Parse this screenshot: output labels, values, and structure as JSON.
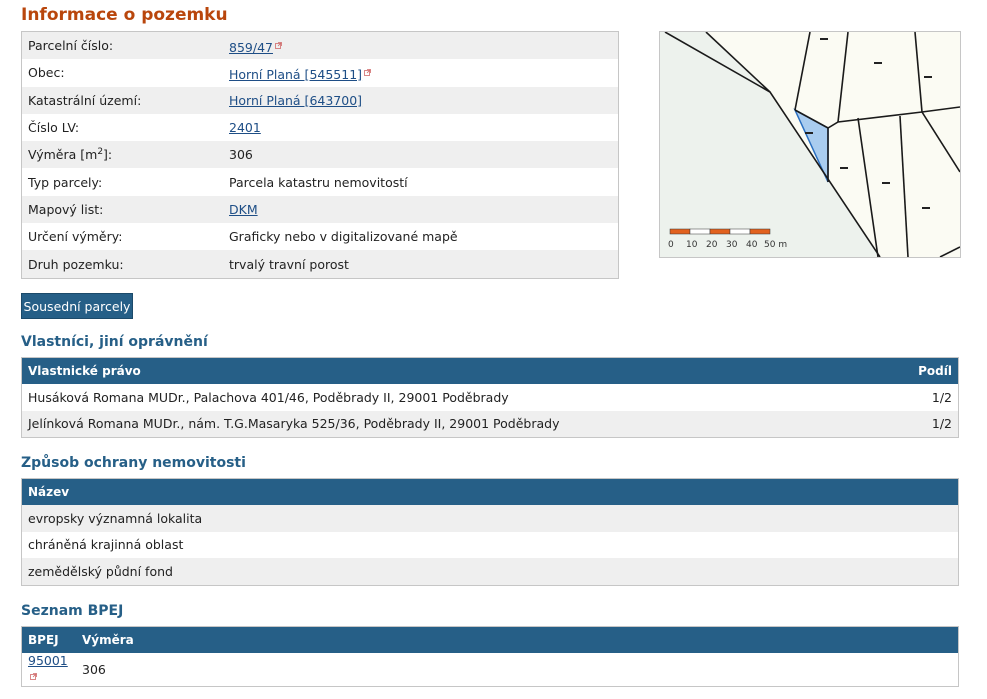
{
  "page": {
    "title": "Informace o pozemku"
  },
  "parcel_info": {
    "rows": [
      {
        "label": "Parcelní číslo:",
        "value": "859/47",
        "link": true,
        "external": true
      },
      {
        "label": "Obec:",
        "value": "Horní Planá [545511]",
        "link": true,
        "external": true
      },
      {
        "label": "Katastrální území:",
        "value": "Horní Planá [643700]",
        "link": true,
        "external": false
      },
      {
        "label": "Číslo LV:",
        "value": "2401",
        "link": true,
        "external": false
      },
      {
        "label_main": "Výměra [m",
        "label_sup": "2",
        "label_end": "]:",
        "value": "306",
        "link": false
      },
      {
        "label": "Typ parcely:",
        "value": "Parcela katastru nemovitostí",
        "link": false
      },
      {
        "label": "Mapový list:",
        "value": "DKM",
        "link": true,
        "external": false
      },
      {
        "label": "Určení výměry:",
        "value": "Graficky nebo v digitalizované mapě",
        "link": false
      },
      {
        "label": "Druh pozemku:",
        "value": "trvalý travní porost",
        "link": false
      }
    ]
  },
  "map": {
    "scale_labels": [
      "0",
      "10",
      "20",
      "30",
      "40",
      "50 m"
    ],
    "colors": {
      "background": "#edf2ed",
      "parcel_fill": "#a9ccef",
      "parcel_stroke": "#2a6fc1",
      "scale_orange": "#e2611e"
    }
  },
  "neighbors_button": {
    "label": "Sousední parcely"
  },
  "owners": {
    "title": "Vlastníci, jiní oprávnění",
    "headers": {
      "right": "Vlastnické právo",
      "share": "Podíl"
    },
    "rows": [
      {
        "name": "Husáková Romana MUDr., Palachova 401/46, Poděbrady II, 29001 Poděbrady",
        "share": "1/2"
      },
      {
        "name": "Jelínková Romana MUDr., nám. T.G.Masaryka 525/36, Poděbrady II, 29001 Poděbrady",
        "share": "1/2"
      }
    ]
  },
  "protection": {
    "title": "Způsob ochrany nemovitosti",
    "header": "Název",
    "rows": [
      "evropsky významná lokalita",
      "chráněná krajinná oblast",
      "zemědělský půdní fond"
    ]
  },
  "bpej": {
    "title": "Seznam BPEJ",
    "headers": {
      "code": "BPEJ",
      "area": "Výměra"
    },
    "rows": [
      {
        "code": "95001",
        "area": "306"
      }
    ]
  },
  "colors": {
    "title_orange": "#b9460c",
    "accent_blue": "#265f87",
    "link_blue": "#1e4e86",
    "row_stripe": "#efefef"
  }
}
